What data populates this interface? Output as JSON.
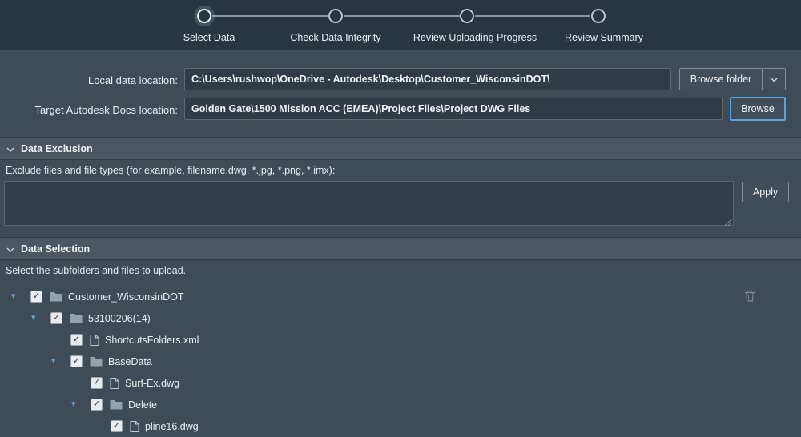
{
  "stepper": {
    "steps": [
      {
        "label": "Select Data",
        "active": true
      },
      {
        "label": "Check Data Integrity",
        "active": false
      },
      {
        "label": "Review Uploading Progress",
        "active": false
      },
      {
        "label": "Review Summary",
        "active": false
      }
    ]
  },
  "locations": {
    "local_label": "Local data location:",
    "local_value": "C:\\Users\\rushwop\\OneDrive - Autodesk\\Desktop\\Customer_WisconsinDOT\\",
    "browse_folder_label": "Browse folder",
    "target_label": "Target Autodesk Docs location:",
    "target_value": "Golden Gate\\1500 Mission ACC (EMEA)\\Project Files\\Project DWG Files",
    "browse_label": "Browse"
  },
  "data_exclusion": {
    "title": "Data Exclusion",
    "hint": "Exclude files and file types (for example, filename.dwg, *.jpg, *.png, *.imx):",
    "textarea_value": "",
    "apply_label": "Apply"
  },
  "data_selection": {
    "title": "Data Selection",
    "hint": "Select the subfolders and files to upload.",
    "tree": [
      {
        "label": "Customer_WisconsinDOT",
        "type": "folder",
        "level": 0,
        "expanded": true,
        "checked": true
      },
      {
        "label": "53100206(14)",
        "type": "folder",
        "level": 1,
        "expanded": true,
        "checked": true
      },
      {
        "label": "ShortcutsFolders.xml",
        "type": "file",
        "level": 2,
        "checked": true
      },
      {
        "label": "BaseData",
        "type": "folder",
        "level": 2,
        "expanded": true,
        "checked": true
      },
      {
        "label": "Surf-Ex.dwg",
        "type": "file",
        "level": 3,
        "checked": true
      },
      {
        "label": "Delete",
        "type": "folder",
        "level": 3,
        "expanded": true,
        "checked": true
      },
      {
        "label": "pline16.dwg",
        "type": "file",
        "level": 4,
        "checked": true
      }
    ]
  },
  "colors": {
    "topbar": "#293642",
    "body": "#3F4B57",
    "section_header": "#4B5662",
    "input_bg": "#303B46",
    "focus_blue": "#57A3E8",
    "expander_blue": "#5EA6DB"
  }
}
